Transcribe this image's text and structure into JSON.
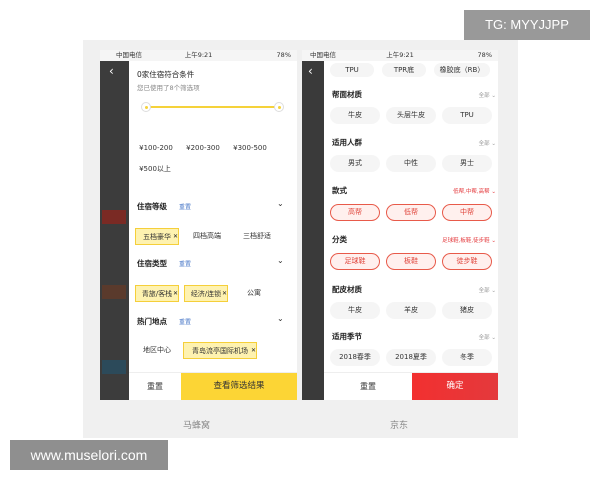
{
  "watermark_top": "TG: MYYJJPP",
  "watermark_bottom": "www.muselori.com",
  "status": {
    "carrier": "中国电信",
    "time": "上午9:21",
    "battery": "78%"
  },
  "left": {
    "caption": "马蜂窝",
    "header_title": "0家住宿符合条件",
    "header_sub": "您已使用了8个筛选项",
    "price_chips": [
      "¥100-200",
      "¥200-300",
      "¥300-500",
      "¥500以上"
    ],
    "sections": [
      {
        "title": "住宿等级",
        "reset": "重置",
        "options": [
          "五档豪华",
          "四档高端",
          "三档舒适"
        ]
      },
      {
        "title": "住宿类型",
        "reset": "重置",
        "options": [
          "青旅/客栈",
          "经济/连锁",
          "公寓"
        ]
      },
      {
        "title": "热门地点",
        "reset": "重置",
        "options": [
          "地区中心",
          "青岛流亭国际机场"
        ]
      }
    ],
    "reset_label": "重置",
    "submit_label": "查看筛选结果"
  },
  "right": {
    "caption": "京东",
    "top_row": [
      "TPU",
      "TPR底",
      "橡胶底（RB）"
    ],
    "sections": [
      {
        "title": "帮面材质",
        "extra": "全部",
        "options": [
          "牛皮",
          "头层牛皮",
          "TPU"
        ]
      },
      {
        "title": "适用人群",
        "extra": "全部",
        "options": [
          "男式",
          "中性",
          "男士"
        ]
      },
      {
        "title": "款式",
        "extra": "低帮,中帮,高帮",
        "options": [
          "高帮",
          "低帮",
          "中帮"
        ]
      },
      {
        "title": "分类",
        "extra": "足球鞋,板鞋,徒步鞋",
        "options": [
          "足球鞋",
          "板鞋",
          "徒步鞋"
        ]
      },
      {
        "title": "配皮材质",
        "extra": "全部",
        "options": [
          "牛皮",
          "羊皮",
          "猪皮"
        ]
      },
      {
        "title": "适用季节",
        "extra": "全部",
        "options": [
          "2018春季",
          "2018夏季",
          "冬季"
        ]
      }
    ],
    "reset_label": "重置",
    "confirm_label": "确定"
  },
  "colors": {
    "mafengwo_yellow": "#fcd535",
    "jd_red": "#e4393c",
    "reset_blue": "#4a78c8"
  }
}
